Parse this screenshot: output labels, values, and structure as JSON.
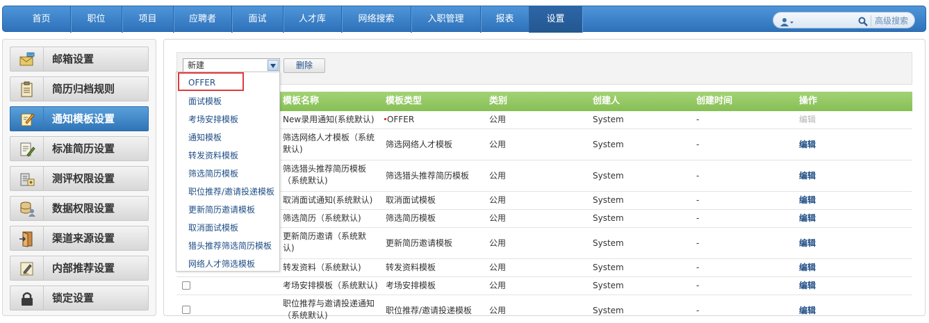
{
  "topnav": {
    "items": [
      {
        "label": "首页"
      },
      {
        "label": "职位"
      },
      {
        "label": "项目"
      },
      {
        "label": "应聘者"
      },
      {
        "label": "面试"
      },
      {
        "label": "人才库"
      },
      {
        "label": "网络搜索"
      },
      {
        "label": "入职管理"
      },
      {
        "label": "报表"
      },
      {
        "label": "设置",
        "active": true
      }
    ],
    "advanced_search": "高级搜索"
  },
  "sidebar": {
    "items": [
      {
        "label": "邮箱设置",
        "icon": "mail-settings-icon"
      },
      {
        "label": "简历归档规则",
        "icon": "clipboard-icon"
      },
      {
        "label": "通知模板设置",
        "icon": "note-edit-icon",
        "active": true
      },
      {
        "label": "标准简历设置",
        "icon": "document-edit-icon"
      },
      {
        "label": "测评权限设置",
        "icon": "building-icon"
      },
      {
        "label": "数据权限设置",
        "icon": "database-user-icon"
      },
      {
        "label": "渠道来源设置",
        "icon": "door-icon"
      },
      {
        "label": "内部推荐设置",
        "icon": "pen-paper-icon"
      },
      {
        "label": "锁定设置",
        "icon": "lock-icon"
      }
    ]
  },
  "toolbar": {
    "select_value": "新建",
    "delete_label": "删除"
  },
  "dropdown": {
    "options": [
      "OFFER",
      "面试模板",
      "考场安排模板",
      "通知模板",
      "转发资料模板",
      "筛选简历模板",
      "职位推荐/邀请投递模板",
      "更新简历邀请模板",
      "取消面试模板",
      "猎头推荐筛选简历模板",
      "网络人才筛选模板"
    ]
  },
  "table": {
    "headers": {
      "name": "模板名称",
      "type": "模板类型",
      "category": "类别",
      "creator": "创建人",
      "created": "创建时间",
      "action": "操作"
    },
    "rows": [
      {
        "name": [
          "New录用通知(系统默认)"
        ],
        "type": "OFFER",
        "category": "公用",
        "creator": "System",
        "created": "-",
        "action": "编辑",
        "action_disabled": true
      },
      {
        "name": [
          "筛选网络人才模板（系统",
          "默认)"
        ],
        "type": "筛选网络人才模板",
        "category": "公用",
        "creator": "System",
        "created": "-",
        "action": "编辑"
      },
      {
        "name": [
          "筛选猎头推荐简历模板",
          "（系统默认)"
        ],
        "type": "筛选猎头推荐简历模板",
        "category": "公用",
        "creator": "System",
        "created": "-",
        "action": "编辑"
      },
      {
        "name": [
          "取消面试通知(系统默认)"
        ],
        "type": "取消面试模板",
        "category": "公用",
        "creator": "System",
        "created": "-",
        "action": "编辑"
      },
      {
        "name": [
          "筛选简历（系统默认)"
        ],
        "type": "筛选简历模板",
        "category": "公用",
        "creator": "System",
        "created": "-",
        "action": "编辑"
      },
      {
        "name": [
          "更新简历邀请（系统默",
          "认)"
        ],
        "type": "更新简历邀请模板",
        "category": "公用",
        "creator": "System",
        "created": "-",
        "action": "编辑"
      },
      {
        "name": [
          "转发资料（系统默认)"
        ],
        "type": "转发资料模板",
        "category": "公用",
        "creator": "System",
        "created": "-",
        "action": "编辑"
      },
      {
        "name": [
          "考场安排模板（系统默认)"
        ],
        "type": "考场安排模板",
        "category": "公用",
        "creator": "System",
        "created": "-",
        "action": "编辑"
      },
      {
        "name": [
          "职位推荐与邀请投递通知",
          "（系统默认)"
        ],
        "type": "职位推荐/邀请投递模板",
        "category": "公用",
        "creator": "System",
        "created": "-",
        "action": "编辑"
      }
    ]
  },
  "colors": {
    "nav_blue": "#3b82c9",
    "header_green": "#93c964",
    "link_blue": "#1f4e86",
    "highlight_red": "#e03a3a"
  }
}
